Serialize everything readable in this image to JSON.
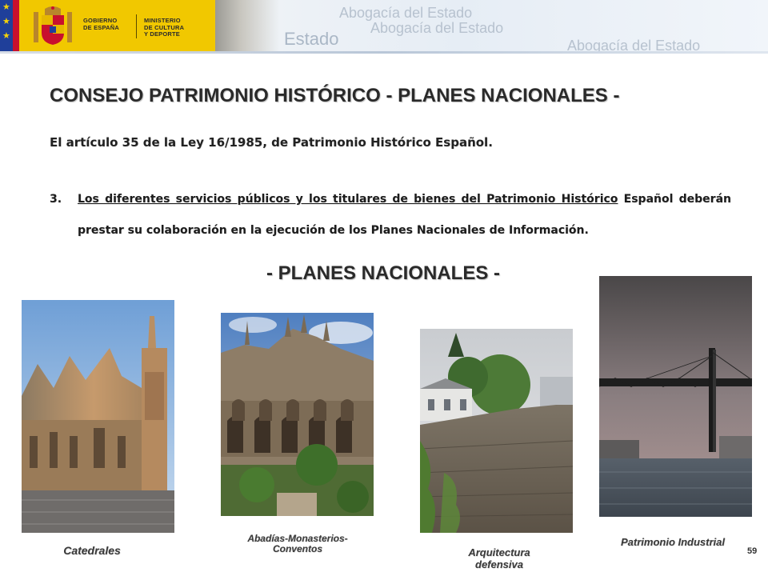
{
  "header": {
    "gov_lines": "GOBIERNO\nDE ESPAÑA",
    "ministry_lines": "MINISTERIO\nDE CULTURA\nY DEPORTE",
    "watermark": "Abogacía del Estado",
    "watermark_short": "Estado"
  },
  "slide": {
    "title": "CONSEJO PATRIMONIO HISTÓRICO - PLANES NACIONALES -",
    "subtitle": "El artículo 35 de la Ley 16/1985, de Patrimonio Histórico Español.",
    "article": {
      "number": "3.",
      "underlined": "Los diferentes servicios públicos y los titulares de bienes del Patrimonio Histórico",
      "rest": " Español deberán prestar su colaboración en la ejecución de los Planes Nacionales de Información."
    },
    "section_title": "- PLANES NACIONALES -",
    "slide_number": "59"
  },
  "photos": [
    {
      "caption": "Catedrales"
    },
    {
      "caption": "Abadías-Monasterios-Conventos"
    },
    {
      "caption": "Arquitectura defensiva"
    },
    {
      "caption": "Patrimonio Industrial"
    }
  ],
  "colors": {
    "gov_yellow": "#f1c800",
    "gov_red": "#c8102e",
    "eu_blue": "#1f3f9a"
  }
}
